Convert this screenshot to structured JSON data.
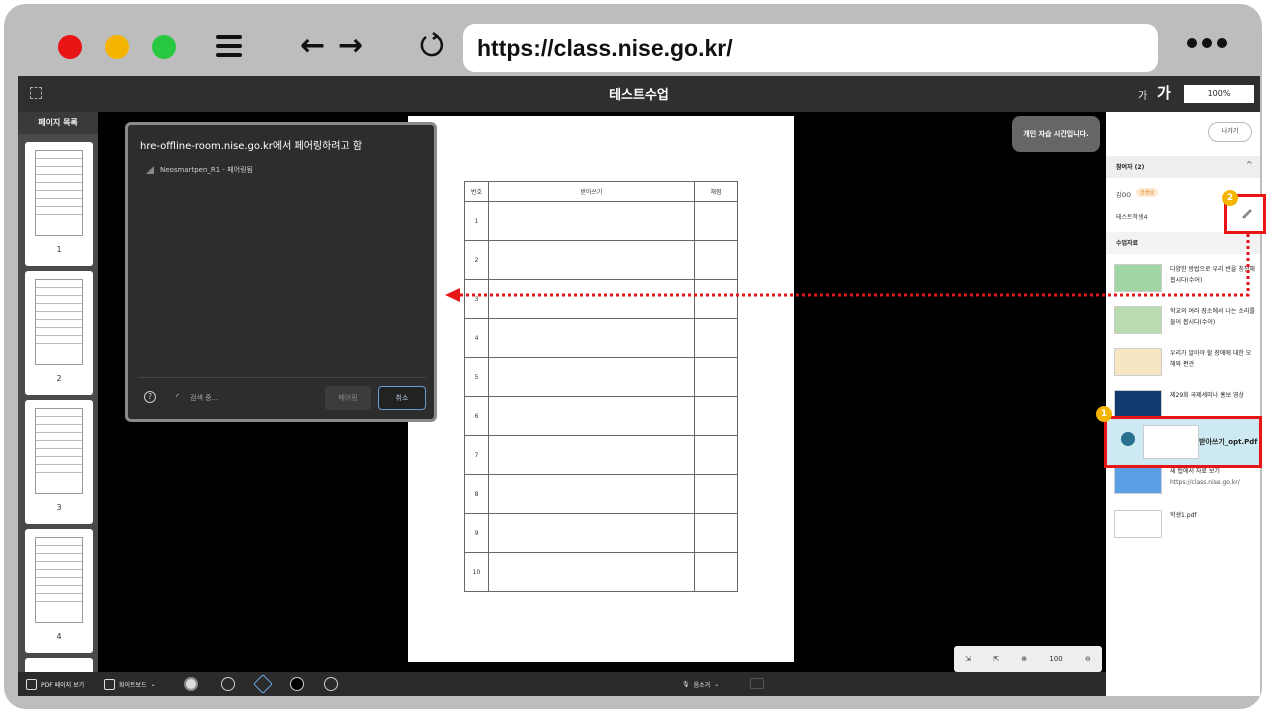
{
  "browser": {
    "url": "https://class.nise.go.kr/",
    "traffic_lights": [
      "#e81416",
      "#f4b400",
      "#28c840"
    ]
  },
  "app": {
    "title": "테스트수업",
    "font_small": "가",
    "font_large": "가",
    "zoom": "100%"
  },
  "page_list": {
    "title": "페이지 목록",
    "pages": [
      "1",
      "2",
      "3",
      "4"
    ]
  },
  "document": {
    "headers": [
      "번호",
      "받아쓰기",
      "채점"
    ],
    "rows": [
      "1",
      "2",
      "3",
      "4",
      "5",
      "6",
      "7",
      "8",
      "9",
      "10"
    ]
  },
  "pair_dialog": {
    "title": "hre-offline-room.nise.go.kr에서 페어링하려고 함",
    "device": "Neosmartpen_R1 - 페어링됨",
    "status": "검색 중...",
    "pair_label": "페어링",
    "cancel_label": "취소"
  },
  "study_notice": "개인 자습 시간입니다.",
  "zoom_toolbar": {
    "level": "100"
  },
  "bottom_toolbar": {
    "pdf_view": "PDF 페이지 보기",
    "whiteboard": "화이트보드",
    "mic": "음소거"
  },
  "right_panel": {
    "exit_label": "나가기",
    "participants_title": "참여자 (2)",
    "participant_1": "김OO",
    "participant_1_badge": "선생님",
    "participant_2": "테스트학생4",
    "materials_title": "수업자료",
    "materials": [
      {
        "label": "다양한 방법으로 우리 반을 칭찬해 봅시다(수어)"
      },
      {
        "label": "학교의 여러 장소에서 나는 소리를 들어 봅시다(수어)"
      },
      {
        "label": "우리가 알아야 할 장애에 대한 오해와 편견"
      },
      {
        "label": "제29회 국제세미나 홍보 영상"
      },
      {
        "label": "받아쓰기_opt.Pdf"
      },
      {
        "label": "새 탭에서 자료 보기",
        "sub": "https://class.nise.go.kr/"
      },
      {
        "label": "학생1.pdf"
      }
    ]
  },
  "callouts": [
    "1",
    "2"
  ],
  "accent_color": "#e81416"
}
